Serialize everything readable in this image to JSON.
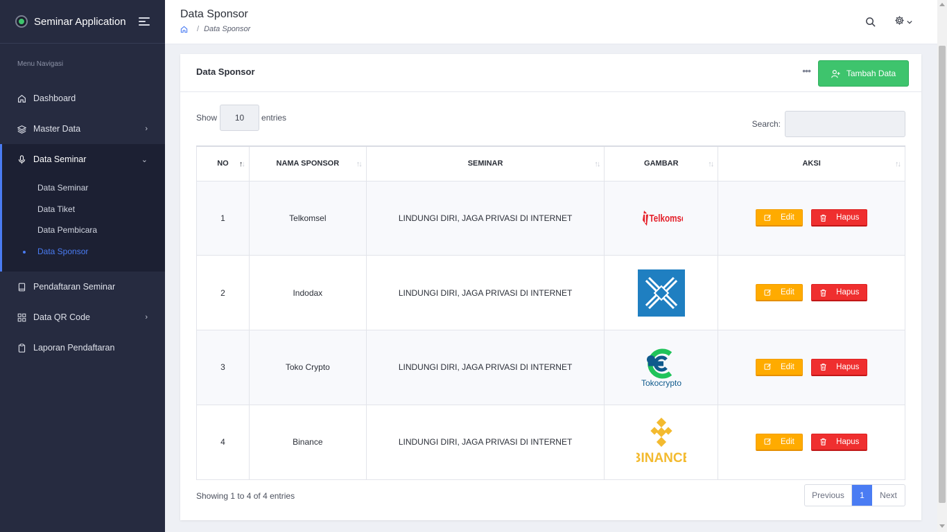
{
  "app": {
    "title": "Seminar Application"
  },
  "sidebar": {
    "section_label": "Menu Navigasi",
    "items": [
      {
        "label": "Dashboard"
      },
      {
        "label": "Master Data"
      },
      {
        "label": "Data Seminar"
      },
      {
        "label": "Pendaftaran Seminar"
      },
      {
        "label": "Data QR Code"
      },
      {
        "label": "Laporan Pendaftaran"
      }
    ],
    "sub_items": [
      {
        "label": "Data Seminar"
      },
      {
        "label": "Data Tiket"
      },
      {
        "label": "Data Pembicara"
      },
      {
        "label": "Data Sponsor"
      }
    ]
  },
  "header": {
    "title": "Data Sponsor",
    "breadcrumb": "Data Sponsor"
  },
  "card": {
    "title": "Data Sponsor",
    "add_label": "Tambah Data",
    "show_label": "Show",
    "entries_value": "10",
    "entries_label": "entries",
    "search_label": "Search:",
    "columns": [
      "NO",
      "NAMA SPONSOR",
      "SEMINAR",
      "GAMBAR",
      "AKSI"
    ],
    "rows": [
      {
        "no": "1",
        "name": "Telkomsel",
        "seminar": "LINDUNGI DIRI, JAGA PRIVASI DI INTERNET",
        "logo": "Telkomsel",
        "edit": "Edit",
        "delete": "Hapus"
      },
      {
        "no": "2",
        "name": "Indodax",
        "seminar": "LINDUNGI DIRI, JAGA PRIVASI DI INTERNET",
        "logo": "",
        "edit": "Edit",
        "delete": "Hapus"
      },
      {
        "no": "3",
        "name": "Toko Crypto",
        "seminar": "LINDUNGI DIRI, JAGA PRIVASI DI INTERNET",
        "logo": "Tokocrypto",
        "edit": "Edit",
        "delete": "Hapus"
      },
      {
        "no": "4",
        "name": "Binance",
        "seminar": "LINDUNGI DIRI, JAGA PRIVASI DI INTERNET",
        "logo": "BINANCE",
        "edit": "Edit",
        "delete": "Hapus"
      }
    ],
    "info": "Showing 1 to 4 of 4 entries",
    "pagination": {
      "previous": "Previous",
      "current": "1",
      "next": "Next"
    }
  },
  "colors": {
    "accent": "#4a7cf3",
    "sidebar_bg": "#262b40",
    "add_button": "#3ec46d",
    "edit_button": "#ffab00",
    "delete_button": "#ef2f2f"
  },
  "icons": [
    "app-logo-icon",
    "menu-toggle-icon",
    "home-icon",
    "layers-icon",
    "microphone-icon",
    "book-icon",
    "qr-grid-icon",
    "clipboard-icon",
    "search-icon",
    "gear-icon",
    "chevron-down-icon",
    "user-plus-icon",
    "edit-icon",
    "trash-icon",
    "more-dots-icon"
  ]
}
